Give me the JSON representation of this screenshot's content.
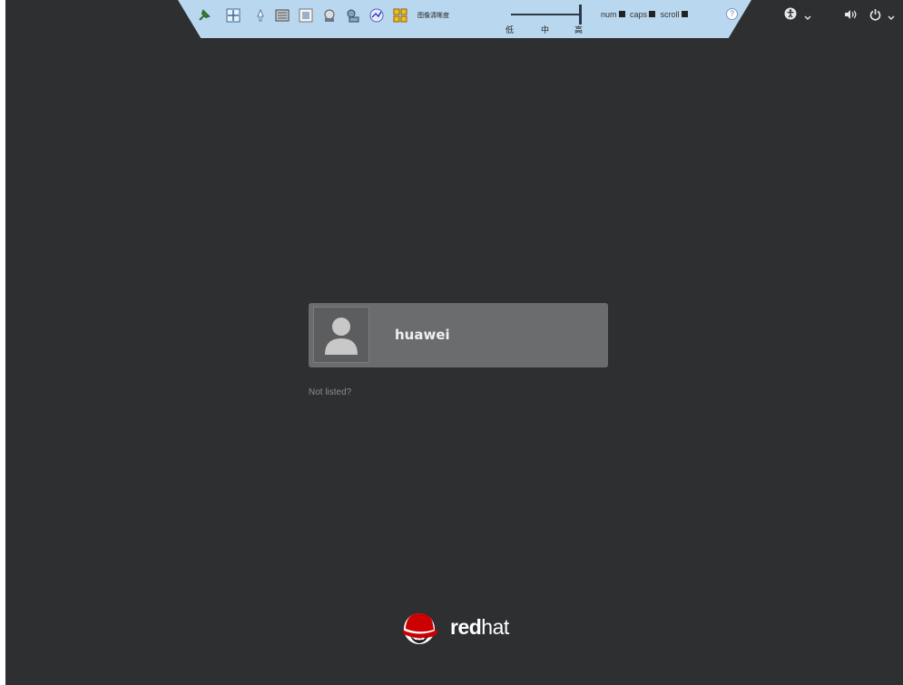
{
  "kvm_toolbar": {
    "label": "图像清晰度",
    "slider_ticks": [
      "低",
      "中",
      "高"
    ],
    "num_label": "num",
    "caps_label": "caps",
    "scroll_label": "scroll",
    "help_symbol": "?"
  },
  "top_right": {
    "accessibility_icon": "accessibility-icon",
    "volume_icon": "volume-icon",
    "power_icon": "power-icon"
  },
  "login": {
    "username": "huawei",
    "not_listed": "Not listed?"
  },
  "logo": {
    "text_bold": "red",
    "text_light": "hat"
  },
  "colors": {
    "background": "#2d2f31",
    "card": "#6b6c6d",
    "toolbar": "#b9d7ee",
    "logo_red": "#cc0000"
  }
}
